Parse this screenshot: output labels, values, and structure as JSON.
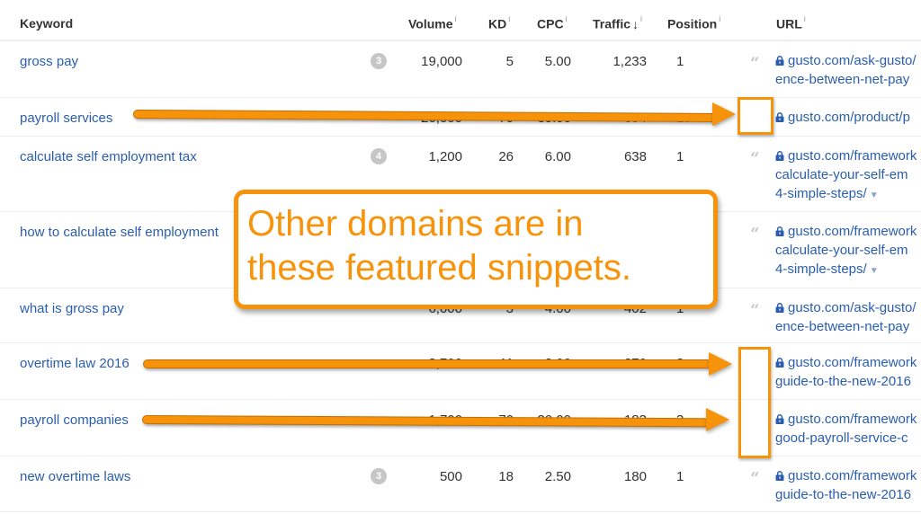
{
  "columns": {
    "keyword": "Keyword",
    "volume": "Volume",
    "kd": "KD",
    "cpc": "CPC",
    "traffic": "Traffic",
    "traffic_sort": "↓",
    "position": "Position",
    "url": "URL",
    "info_glyph": "i"
  },
  "rows": [
    {
      "keyword": "gross pay",
      "kd_badge": "3",
      "volume": "19,000",
      "kd": "5",
      "cpc": "5.00",
      "traffic": "1,233",
      "position": "1",
      "featured_snippet": true,
      "url_lines": [
        "gusto.com/ask-gusto/",
        "ence-between-net-pay"
      ],
      "url_dropdown": false
    },
    {
      "keyword": "payroll services",
      "kd_badge": "",
      "volume": "20,000",
      "kd": "70",
      "cpc": "35.00",
      "traffic": "354",
      "position": "10",
      "featured_snippet": false,
      "url_lines": [
        "gusto.com/product/p"
      ],
      "url_dropdown": false
    },
    {
      "keyword": "calculate self employment tax",
      "kd_badge": "4",
      "volume": "1,200",
      "kd": "26",
      "cpc": "6.00",
      "traffic": "638",
      "position": "1",
      "featured_snippet": true,
      "url_lines": [
        "gusto.com/framework",
        "calculate-your-self-em",
        "4-simple-steps/"
      ],
      "url_dropdown": true
    },
    {
      "keyword": "how to calculate self employment",
      "kd_badge": "",
      "volume": "",
      "kd": "",
      "cpc": "",
      "traffic": "",
      "position": "",
      "featured_snippet": true,
      "url_lines": [
        "gusto.com/framework",
        "calculate-your-self-em",
        "4-simple-steps/"
      ],
      "url_dropdown": true
    },
    {
      "keyword": "what is gross pay",
      "kd_badge": "",
      "volume": "6,000",
      "kd": "3",
      "cpc": "4.00",
      "traffic": "402",
      "position": "1",
      "featured_snippet": true,
      "url_lines": [
        "gusto.com/ask-gusto/",
        "ence-between-net-pay"
      ],
      "url_dropdown": false
    },
    {
      "keyword": "overtime law 2016",
      "kd_badge": "",
      "volume": "3,700",
      "kd": "11",
      "cpc": "2.00",
      "traffic": "270",
      "position": "3",
      "featured_snippet": false,
      "url_lines": [
        "gusto.com/framework",
        "guide-to-the-new-2016"
      ],
      "url_dropdown": false
    },
    {
      "keyword": "payroll companies",
      "kd_badge": "",
      "volume": "1,700",
      "kd": "70",
      "cpc": "30.00",
      "traffic": "183",
      "position": "3",
      "featured_snippet": false,
      "url_lines": [
        "gusto.com/framework",
        "good-payroll-service-c"
      ],
      "url_dropdown": false
    },
    {
      "keyword": "new overtime laws",
      "kd_badge": "3",
      "volume": "500",
      "kd": "18",
      "cpc": "2.50",
      "traffic": "180",
      "position": "1",
      "featured_snippet": true,
      "url_lines": [
        "gusto.com/framework",
        "guide-to-the-new-2016"
      ],
      "url_dropdown": false
    }
  ],
  "annotation": {
    "callout_line1": "Other domains are in",
    "callout_line2": "these featured snippets.",
    "color": "#f7930a"
  },
  "icons": {
    "lock": "lock-icon",
    "quote": "featured-snippet-quote-icon",
    "dropdown": "dropdown-triangle-icon",
    "info": "info-icon",
    "sort": "sort-down-arrow-icon"
  },
  "glyphs": {
    "quote": "“",
    "triangle": "▼"
  }
}
